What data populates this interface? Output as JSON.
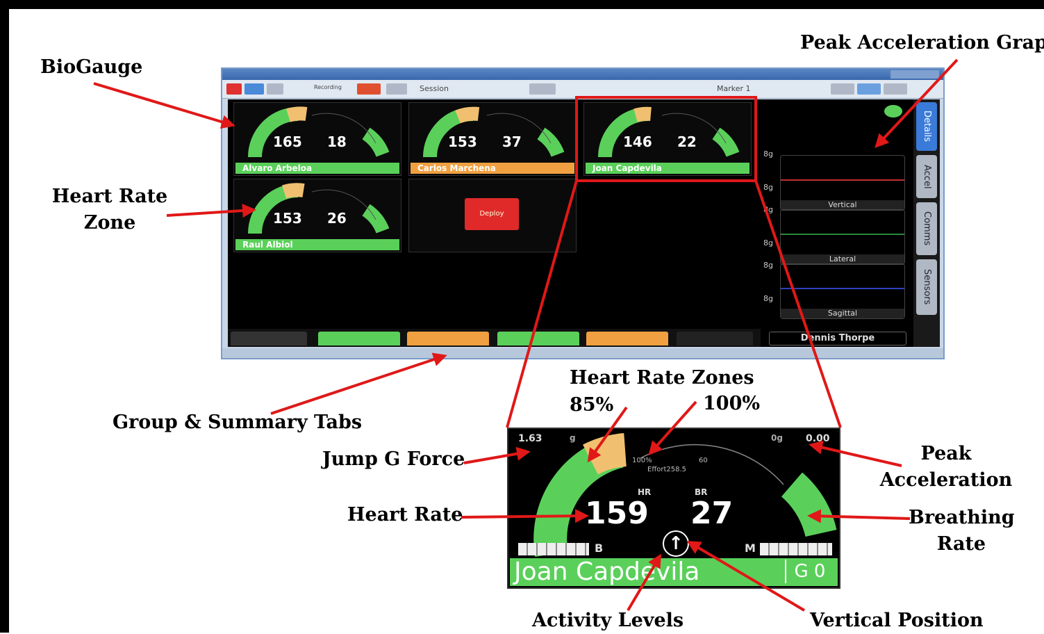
{
  "callouts": {
    "biogauge": "BioGauge",
    "peak_acc_graph": "Peak Acceleration Graph",
    "hr_zone_line1": "Heart Rate",
    "hr_zone_line2": "Zone",
    "group_tabs": "Group & Summary Tabs",
    "hr_zones": "Heart Rate Zones",
    "pct85": "85%",
    "pct100": "100%",
    "jump_g": "Jump G Force",
    "heart_rate": "Heart Rate",
    "peak_acc_line1": "Peak",
    "peak_acc_line2": "Acceleration",
    "breathing_line1": "Breathing",
    "breathing_line2": "Rate",
    "activity": "Activity Levels",
    "vertical_pos": "Vertical Position"
  },
  "app": {
    "toolbar_session": "Session",
    "toolbar_marker": "Marker 1",
    "toolbar_recording": "Recording",
    "side_tabs": [
      "Details",
      "Accel",
      "Comms",
      "Sensors"
    ],
    "graph_labels": [
      "Vertical",
      "Lateral",
      "Sagittal"
    ],
    "graph_ticks": [
      "8g",
      "8g",
      "8g",
      "8g",
      "8g",
      "8g"
    ],
    "selected_athlete": "Dennis Thorpe",
    "center_button": "Deploy"
  },
  "gauges": [
    {
      "hr": "165",
      "br": "18",
      "name": "Alvaro Arbeloa",
      "name_color": "#5ad05a"
    },
    {
      "hr": "153",
      "br": "37",
      "name": "Carlos Marchena",
      "name_color": "#f0a040"
    },
    {
      "hr": "146",
      "br": "22",
      "name": "Joan Capdevila",
      "name_color": "#5ad05a"
    },
    {
      "hr": "153",
      "br": "26",
      "name": "Raul Albiol",
      "name_color": "#5ad05a"
    }
  ],
  "zoom": {
    "jump_g": "1.63",
    "g_unit": "g",
    "peak_unit": "0g",
    "peak_value": "0.00",
    "zone_pct": "100%",
    "zone_val": "60",
    "effort": "Effort258.5",
    "hr_label": "HR",
    "br_label": "BR",
    "hr": "159",
    "br": "27",
    "b_label": "B",
    "m_label": "M",
    "name": "Joan Capdevila",
    "g_badge": "G 0"
  },
  "colors": {
    "arrow": "#e01818",
    "gauge_green": "#5ad05a",
    "gauge_orange": "#f0a040",
    "highlight": "#e01818"
  }
}
